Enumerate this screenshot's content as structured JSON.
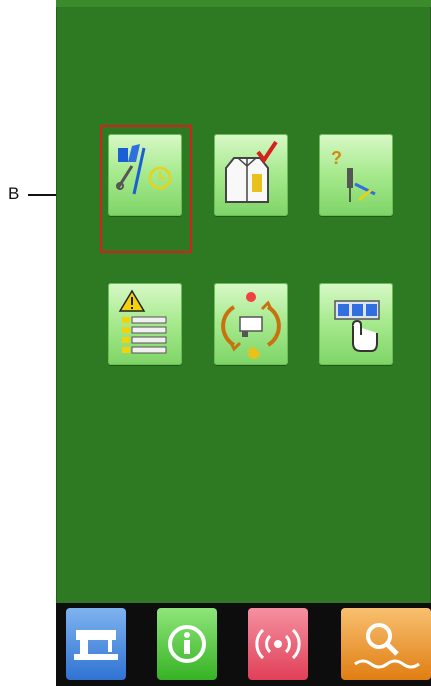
{
  "callout": {
    "label": "B"
  },
  "grid": {
    "buttons": [
      {
        "icon": "maintenance-settings-icon",
        "selected": true
      },
      {
        "icon": "clothing-check-icon",
        "selected": false
      },
      {
        "icon": "needle-help-icon",
        "selected": false
      },
      {
        "icon": "warning-list-icon",
        "selected": false
      },
      {
        "icon": "machine-cycle-icon",
        "selected": false
      },
      {
        "icon": "keypad-touch-icon",
        "selected": false
      }
    ]
  },
  "bottom_tabs": [
    {
      "icon": "sewing-machine-icon",
      "color": "#2f73d3"
    },
    {
      "icon": "information-icon",
      "color": "#36b325"
    },
    {
      "icon": "communication-icon",
      "color": "#e04058"
    },
    {
      "icon": "search-icon",
      "color": "#e07e12"
    }
  ],
  "colors": {
    "screen_background": "#2e7a22",
    "button_face": "#a7ea8e",
    "selection_frame": "#d62020",
    "bottom_bar": "#0d0d0d"
  }
}
